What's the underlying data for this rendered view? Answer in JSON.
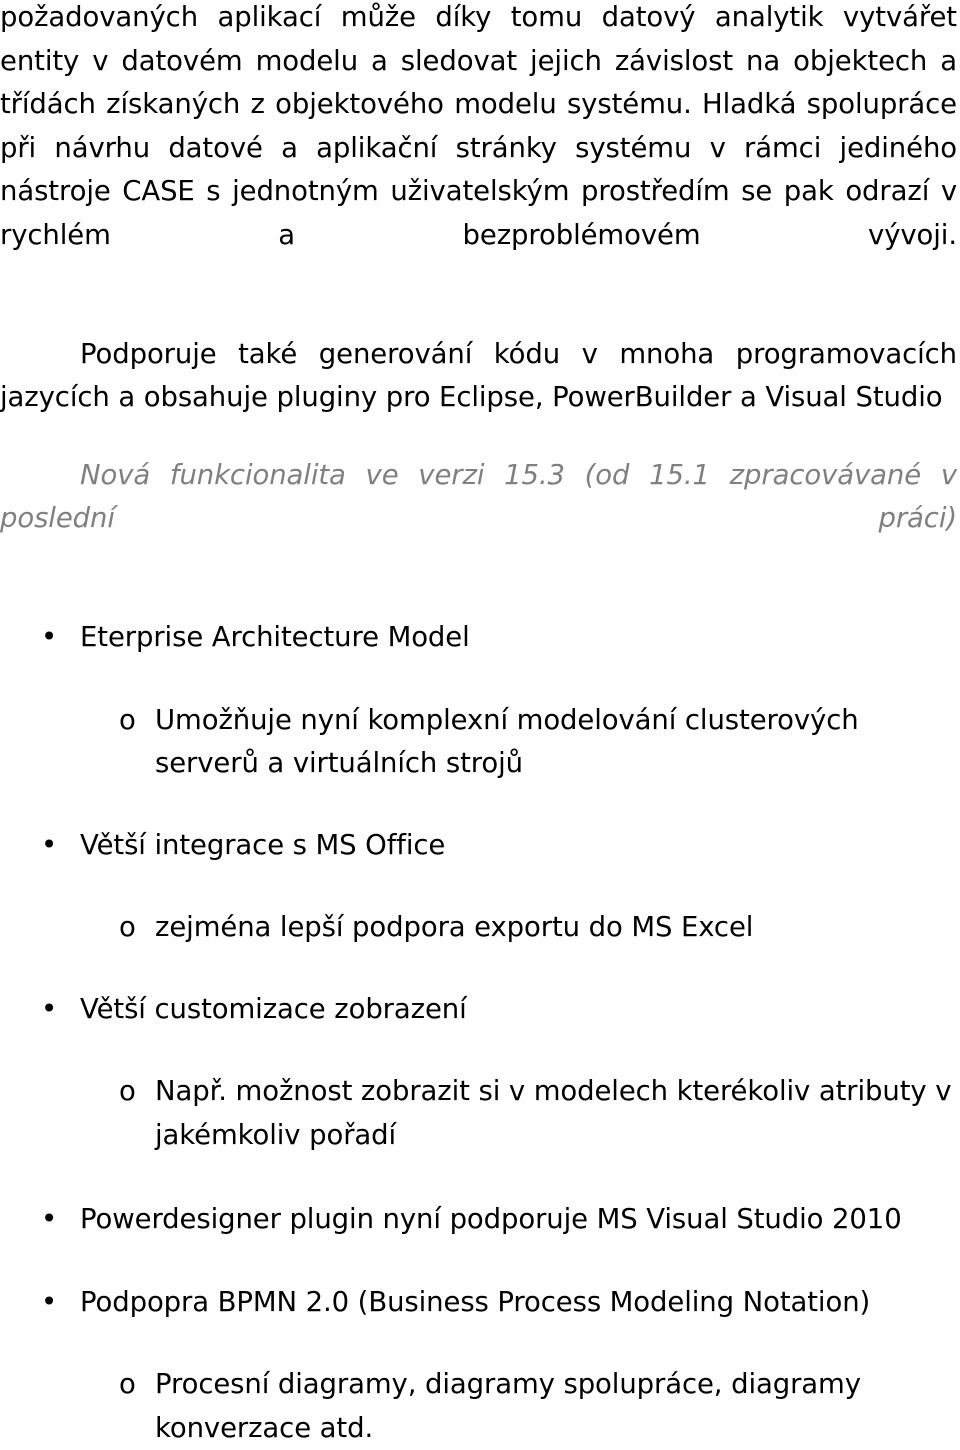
{
  "document": {
    "body_paragraphs": [
      {
        "id": "continued-paragraph",
        "text": "požadovaných aplikací může díky tomu datový analytik vytvářet entity v datovém modelu a sledovat jejich závislost na objektech a třídách získaných z objektového modelu systému. Hladká spolupráce při návrhu datové a aplikační stránky systému v rámci jediného nástroje CASE s jednotným uživatelským prostředím se pak odrazí v rychlém a bezproblémovém vývoji."
      },
      {
        "id": "plugins-paragraph",
        "text": "Podporuje také generování kódu v mnoha programovacích jazycích a obsahuje pluginy pro Eclipse, PowerBuilder a Visual Studio"
      }
    ],
    "note_italic": {
      "id": "new-functionality-note",
      "text": "Nová funkcionalita ve verzi 15.3 (od 15.1 zpracovávané v poslední práci)",
      "color": "#808080"
    },
    "bullet_marker": "•",
    "sub_bullet_marker": "o",
    "list": [
      {
        "label": "Eterprise Architecture Model",
        "children": [
          "Umožňuje nyní komplexní modelování clusterových serverů a virtuálních strojů"
        ]
      },
      {
        "label": "Větší integrace s MS Office",
        "children": [
          "zejména lepší podpora exportu do MS Excel"
        ]
      },
      {
        "label": "Větší customizace zobrazení",
        "children": [
          "Např. možnost zobrazit si v modelech kterékoliv atributy v jakémkoliv pořadí"
        ]
      },
      {
        "label": "Powerdesigner plugin nyní podporuje MS Visual Studio 2010",
        "children": []
      },
      {
        "label": "Podpopra BPMN 2.0 (Business Process Modeling Notation)",
        "children": [
          "Procesní diagramy, diagramy spolupráce, diagramy konverzace atd."
        ]
      }
    ]
  }
}
